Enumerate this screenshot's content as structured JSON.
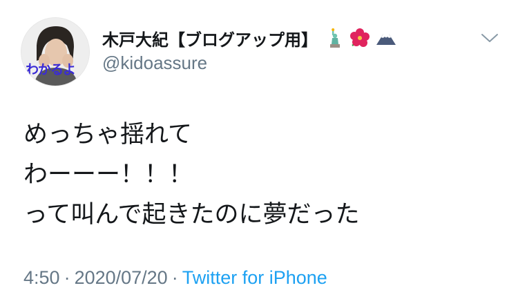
{
  "tweet": {
    "display_name": "木戸大紀【ブログアップ用】",
    "name_emojis": [
      "statue-of-liberty-icon",
      "hibiscus-icon",
      "mount-fuji-icon"
    ],
    "handle": "@kidoassure",
    "avatar_caption": "わかるよ",
    "body_lines": [
      "めっちゃ揺れて",
      "わーーー！！！",
      "って叫んで起きたのに夢だった"
    ],
    "time": "4:50",
    "separator": "·",
    "date": "2020/07/20",
    "source": "Twitter for iPhone"
  },
  "colors": {
    "text": "#14171a",
    "secondary": "#657786",
    "link": "#1da1f2",
    "avatar_caption": "#3a2bd6"
  }
}
